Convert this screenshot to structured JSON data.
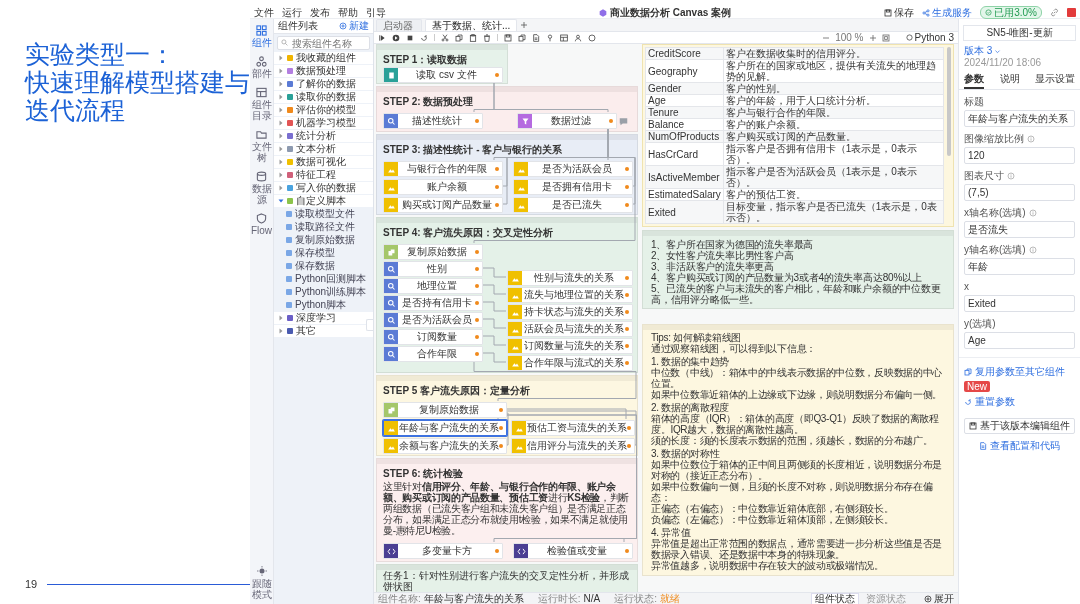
{
  "slide": {
    "title_lines": [
      "实验类型一：",
      "快速理解模型搭建与",
      "迭代流程"
    ],
    "page_number": "19"
  },
  "menu": [
    "文件",
    "运行",
    "发布",
    "帮助",
    "引导"
  ],
  "app_title": "商业数据分析 Canvas 案例",
  "header_actions": [
    {
      "kind": "save",
      "label": "保存"
    },
    {
      "kind": "publish",
      "label": "生成服务"
    },
    {
      "kind": "badge",
      "label": "已用3.0%"
    }
  ],
  "rail": [
    {
      "label": "组件",
      "selected": true
    },
    {
      "label": "部件",
      "selected": false
    },
    {
      "label": "组件目录",
      "selected": false
    },
    {
      "label": "文件树",
      "selected": false
    },
    {
      "label": "数据源",
      "selected": false
    },
    {
      "label": "Flow",
      "selected": false
    }
  ],
  "rail_footer": "跟随模式",
  "tree": {
    "title": "组件列表",
    "new_label": "新建",
    "search_placeholder": "搜索组件名称",
    "items": [
      {
        "label": "我收藏的组件",
        "expanded": false
      },
      {
        "label": "数据预处理",
        "expanded": false
      },
      {
        "label": "了解你的数据",
        "expanded": false
      },
      {
        "label": "读取你的数据",
        "expanded": false
      },
      {
        "label": "评估你的模型",
        "expanded": false
      },
      {
        "label": "机器学习模型",
        "expanded": false
      },
      {
        "label": "统计分析",
        "expanded": false
      },
      {
        "label": "文本分析",
        "expanded": false
      },
      {
        "label": "数据可视化",
        "expanded": false
      },
      {
        "label": "特征工程",
        "expanded": false
      },
      {
        "label": "写入你的数据",
        "expanded": false
      },
      {
        "label": "自定义脚本",
        "expanded": true,
        "children": [
          {
            "label": "读取模型文件"
          },
          {
            "label": "读取路径文件"
          },
          {
            "label": "复制原始数据"
          },
          {
            "label": "保存模型"
          },
          {
            "label": "保存数据"
          },
          {
            "label": "Python回测脚本"
          },
          {
            "label": "Python训练脚本"
          },
          {
            "label": "Python脚本"
          }
        ]
      },
      {
        "label": "深度学习",
        "expanded": false
      },
      {
        "label": "其它",
        "expanded": false
      }
    ]
  },
  "tabs": [
    {
      "label": "启动器",
      "selected": false
    },
    {
      "label": "基于数据、统计...",
      "selected": true
    }
  ],
  "kernel": "Python 3",
  "canvas_zoom": "100 %",
  "canvas": {
    "groups": [
      {
        "title": "STEP 1：读取数据",
        "color": "#e6f2ea",
        "nodes": [
          {
            "label": "读取 csv 文件",
            "kind": "read",
            "selected": false,
            "comment": false
          }
        ]
      },
      {
        "title": "STEP 2: 数据预处理",
        "color": "#fbeded",
        "nodes": [
          {
            "label": "描述性统计",
            "kind": "stats",
            "selected": false,
            "comment": false
          },
          {
            "label": "数据过滤",
            "kind": "filter",
            "selected": false,
            "comment": true
          }
        ]
      },
      {
        "title": "STEP 3: 描述性统计 - 客户与银行的关系",
        "color": "#e8edf6",
        "nodes": [
          {
            "label": "与银行合作的年限",
            "kind": "chart",
            "selected": false,
            "comment": false
          },
          {
            "label": "是否为活跃会员",
            "kind": "chart",
            "selected": false,
            "comment": false
          },
          {
            "label": "账户余额",
            "kind": "chart",
            "selected": false,
            "comment": false
          },
          {
            "label": "是否拥有信用卡",
            "kind": "chart",
            "selected": false,
            "comment": false
          },
          {
            "label": "购买或订阅产品数量",
            "kind": "chart",
            "selected": false,
            "comment": false
          },
          {
            "label": "是否已流失",
            "kind": "chart",
            "selected": false,
            "comment": false
          }
        ]
      },
      {
        "title": "STEP 4: 客户流失原因：交叉定性分析",
        "color": "#e4f1e8",
        "nodes": [
          {
            "label": "复制原始数据",
            "kind": "copy",
            "selected": false,
            "comment": false
          },
          {
            "label": "性别",
            "kind": "stats",
            "selected": false,
            "comment": false
          },
          {
            "label": "性别与流失的关系",
            "kind": "chart",
            "selected": false,
            "comment": false
          },
          {
            "label": "地理位置",
            "kind": "stats",
            "selected": false,
            "comment": false
          },
          {
            "label": "流失与地理位置的关系",
            "kind": "chart",
            "selected": false,
            "comment": false
          },
          {
            "label": "是否持有信用卡",
            "kind": "stats",
            "selected": false,
            "comment": false
          },
          {
            "label": "持卡状态与流失的关系",
            "kind": "chart",
            "selected": false,
            "comment": false
          },
          {
            "label": "是否为活跃会员",
            "kind": "stats",
            "selected": false,
            "comment": false
          },
          {
            "label": "活跃会员与流失的关系",
            "kind": "chart",
            "selected": false,
            "comment": false
          },
          {
            "label": "订阅数量",
            "kind": "stats",
            "selected": false,
            "comment": false
          },
          {
            "label": "订阅数量与流失的关系",
            "kind": "chart",
            "selected": false,
            "comment": false
          },
          {
            "label": "合作年限",
            "kind": "stats",
            "selected": false,
            "comment": false
          },
          {
            "label": "合作年限与流式的关系",
            "kind": "chart",
            "selected": false,
            "comment": false
          }
        ]
      },
      {
        "title": "STEP 5 客户流失原因：定量分析",
        "color": "#fdf7e1",
        "nodes": [
          {
            "label": "复制原始数据",
            "kind": "copy",
            "selected": false,
            "comment": false
          },
          {
            "label": "年龄与客户流失的关系",
            "kind": "chart",
            "selected": true,
            "comment": false
          },
          {
            "label": "预估工资与流失的关系",
            "kind": "chart",
            "selected": false,
            "comment": false
          },
          {
            "label": "余额与客户流失的关系",
            "kind": "chart",
            "selected": false,
            "comment": false
          },
          {
            "label": "信用评分与流失的关系",
            "kind": "chart",
            "selected": false,
            "comment": false
          }
        ]
      },
      {
        "title": "STEP 6: 统计检验",
        "color": "#fcefef",
        "description": "这里针对**信用评分、年龄、与银行合作的年限、账户余额、购买或订阅的产品数量、预估工资**进行**KS检验**，判断两组数据（已流失客户组和未流失客户组）是否满足正态分布，如果满足正态分布就使用t检验，如果不满足就使用曼-惠特尼U检验。",
        "nodes": [
          {
            "label": "多变量卡方",
            "kind": "test",
            "selected": false,
            "comment": false
          },
          {
            "label": "检验值或变量",
            "kind": "test",
            "selected": false,
            "comment": false
          }
        ]
      }
    ],
    "data_dictionary": [
      {
        "field": "CreditScore",
        "description": "客户在数据收集时的信用评分。"
      },
      {
        "field": "Geography",
        "description": "客户所在的国家或地区，提供有关流失的地理趋势的见解。"
      },
      {
        "field": "Gender",
        "description": "客户的性别。"
      },
      {
        "field": "Age",
        "description": "客户的年龄，用于人口统计分析。"
      },
      {
        "field": "Tenure",
        "description": "客户与银行合作的年限。"
      },
      {
        "field": "Balance",
        "description": "客户的账户余额。"
      },
      {
        "field": "NumOfProducts",
        "description": "客户购买或订阅的产品数量。"
      },
      {
        "field": "HasCrCard",
        "description": "指示客户是否拥有信用卡（1表示是，0表示否）。"
      },
      {
        "field": "IsActiveMember",
        "description": "指示客户是否为活跃会员（1表示是，0表示否）。"
      },
      {
        "field": "EstimatedSalary",
        "description": "客户的预估工资。"
      },
      {
        "field": "Exited",
        "description": "目标变量，指示客户是否已流失（1表示是，0表示否）。"
      }
    ],
    "notes": [
      {
        "kind": "task",
        "lines": [
          "任务1：针对性别进行客户流失的交叉定性分析，并形成饼状图"
        ]
      },
      {
        "kind": "findings",
        "lines": [
          "1、客户所在国家为德国的流失率最高",
          "2、女性客户流失率比男性客户高",
          "3、非活跃客户的流失率更高",
          "4、客户购买或订阅的产品数量为3或者4的流失率高达80%以上",
          "5、已流失的客户与未流失的客户相比，年龄和账户余额的中位数更高，信用评分略低一些。"
        ]
      },
      {
        "kind": "tips",
        "sections": [
          {
            "lines": [
              "Tips: 如何解读箱线图",
              "通过观察箱线图，可以得到以下信息："
            ]
          },
          {
            "lines": [
              "1. 数据的集中趋势",
              "中位数（中线）：箱体中的中线表示数据的中位数，反映数据的中心位置。",
              "如果中位数靠近箱体的上边缘或下边缘，则说明数据分布偏向一侧。"
            ]
          },
          {
            "lines": [
              "2. 数据的离散程度",
              "箱体的高度（IQR）：箱体的高度（即Q3-Q1）反映了数据的离散程度。IQR越大，数据的离散性越高。",
              "须的长度：须的长度表示数据的范围，须越长，数据的分布越广。"
            ]
          },
          {
            "lines": [
              "3. 数据的对称性",
              "如果中位数位于箱体的正中间且两侧须的长度相近，说明数据分布是对称的（接近正态分布）。",
              "如果中位数偏向一侧，且须的长度不对称，则说明数据分布存在偏态：",
              "正偏态（右偏态）：中位数靠近箱体底部，右侧须较长。",
              "负偏态（左偏态）：中位数靠近箱体顶部，左侧须较长。"
            ]
          },
          {
            "lines": [
              "4. 异常值",
              "异常值是超出正常范围的数据点，通常需要进一步分析这些值是否是数据录入错误、还是数据中本身的特殊现象。",
              "异常值越多，说明数据中存在较大的波动或极端情况。"
            ]
          }
        ]
      }
    ]
  },
  "status": {
    "fields": [
      {
        "label": "组件名称:",
        "value": "年龄与客户流失的关系",
        "kind": "text"
      },
      {
        "label": "运行时长:",
        "value": "N/A",
        "kind": "text"
      },
      {
        "label": "运行状态:",
        "value": "就绪",
        "kind": "state"
      }
    ],
    "tabs": [
      {
        "label": "组件状态",
        "selected": true
      },
      {
        "label": "资源状态",
        "selected": false
      }
    ],
    "expand": "展开"
  },
  "panel": {
    "title": "SN5-唯图-更新",
    "version": "版本 3",
    "date": "2024/11/20 18:06",
    "tabs": [
      {
        "label": "参数",
        "selected": true
      },
      {
        "label": "说明",
        "selected": false
      },
      {
        "label": "显示设置",
        "selected": false
      }
    ],
    "fields": [
      {
        "label": "标题",
        "info": false,
        "value": "年龄与客户流失的关系"
      },
      {
        "label": "图像缩放比例",
        "info": true,
        "value": "120"
      },
      {
        "label": "图表尺寸",
        "info": true,
        "value": "(7,5)"
      },
      {
        "label": "x轴名称(选填)",
        "info": true,
        "value": "是否流失"
      },
      {
        "label": "y轴名称(选填)",
        "info": true,
        "value": "年龄"
      },
      {
        "label": "x",
        "info": false,
        "value": "Exited"
      },
      {
        "label": "y(选填)",
        "info": false,
        "value": "Age"
      }
    ],
    "links": [
      {
        "kind": "copy",
        "label": "复用参数至其它组件",
        "badge": "New"
      },
      {
        "kind": "reset",
        "label": "重置参数"
      }
    ],
    "edit_button": "基于该版本编辑组件",
    "code_link": "查看配置和代码"
  }
}
